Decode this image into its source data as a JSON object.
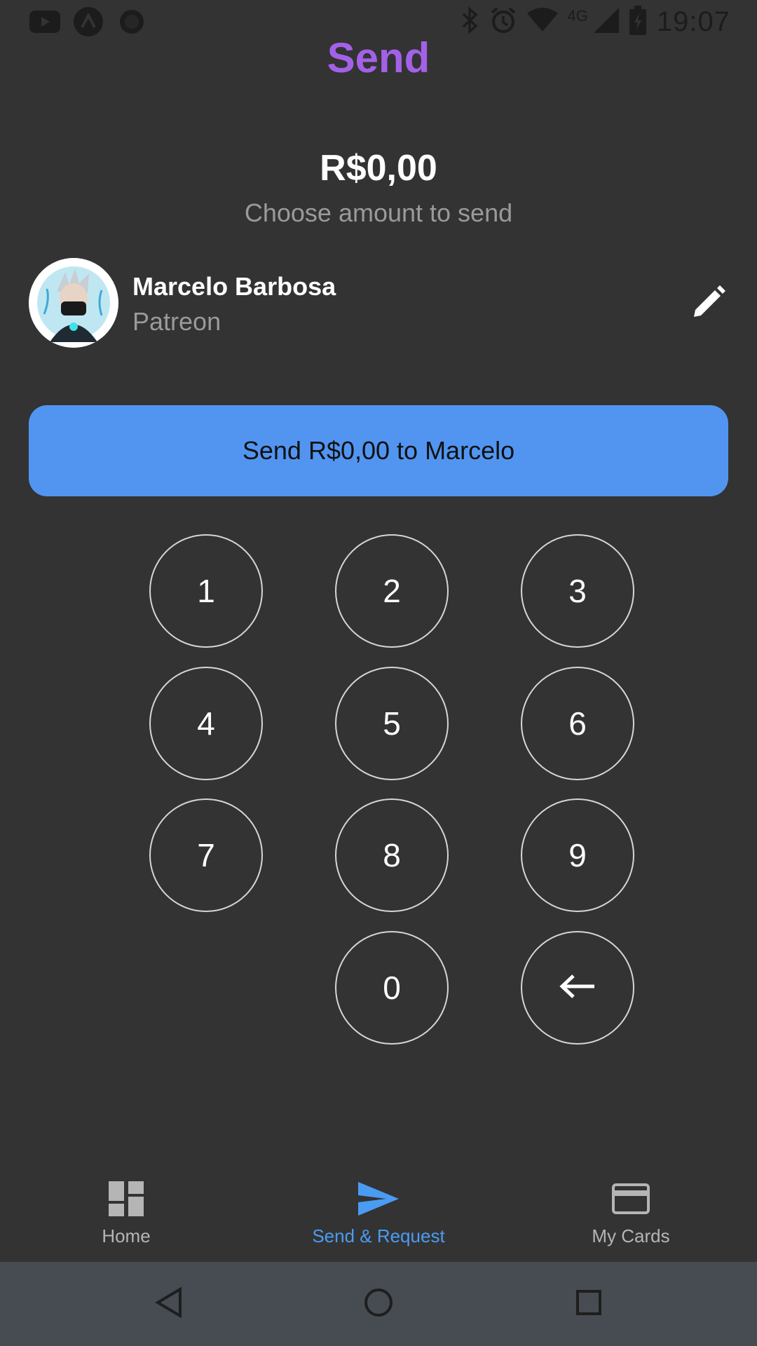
{
  "status_bar": {
    "time": "19:07",
    "network_label": "4G",
    "left_icons": [
      "youtube-icon",
      "app-icon",
      "circle-icon"
    ],
    "right_icons": [
      "bluetooth-icon",
      "alarm-icon",
      "wifi-icon",
      "signal-icon",
      "battery-icon"
    ]
  },
  "header": {
    "title": "Send"
  },
  "amount": {
    "value": "R$0,00",
    "hint": "Choose amount to send"
  },
  "recipient": {
    "name": "Marcelo Barbosa",
    "subtitle": "Patreon"
  },
  "send_button": {
    "label": "Send R$0,00 to Marcelo"
  },
  "keypad": {
    "keys": [
      "1",
      "2",
      "3",
      "4",
      "5",
      "6",
      "7",
      "8",
      "9",
      "0"
    ],
    "backspace_icon": "arrow-left-icon"
  },
  "bottom_nav": {
    "items": [
      {
        "label": "Home",
        "icon": "dashboard-icon",
        "active": false
      },
      {
        "label": "Send & Request",
        "icon": "send-icon",
        "active": true
      },
      {
        "label": "My Cards",
        "icon": "credit-card-icon",
        "active": false
      }
    ],
    "active_color": "#4a9cf3",
    "inactive_color": "#b5b5b5"
  },
  "colors": {
    "background": "#333333",
    "title": "#a361e8",
    "button": "#5195f1",
    "system_nav": "#474c53"
  }
}
